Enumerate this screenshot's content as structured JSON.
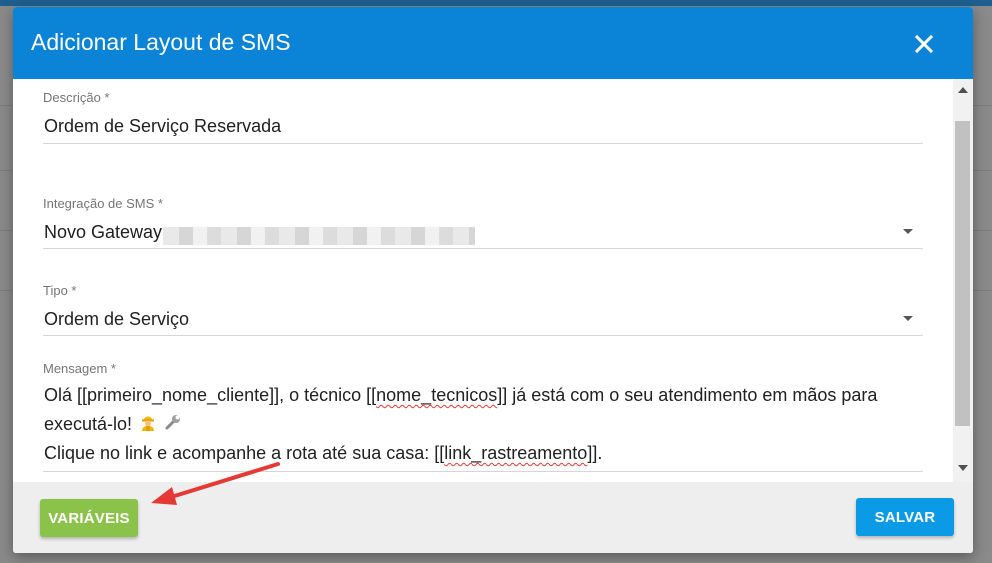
{
  "modal": {
    "title": "Adicionar Layout de SMS",
    "close_icon": "close-icon"
  },
  "form": {
    "descricao": {
      "label": "Descrição *",
      "value": "Ordem de Serviço Reservada"
    },
    "integracao": {
      "label": "Integração de SMS *",
      "value": "Novo Gateway"
    },
    "tipo": {
      "label": "Tipo *",
      "value": "Ordem de Serviço"
    },
    "mensagem": {
      "label": "Mensagem *",
      "line1_a": "Olá [[primeiro_nome_cliente]], o técnico [[",
      "line1_b": "nome_tecnicos",
      "line1_c": "]] já está com o seu atendimento em mãos para",
      "line2": "executá-lo!",
      "line2_icons": [
        "construction-worker-icon",
        "wrench-icon"
      ],
      "line3_a": "Clique no link e acompanhe a rota até sua casa: [[",
      "line3_b": "link_rastreamento",
      "line3_c": "]]."
    }
  },
  "footer": {
    "variables_label": "VARIÁVEIS",
    "save_label": "SALVAR"
  },
  "colors": {
    "header": "#0b83d6",
    "variables_button": "#8bc34a",
    "save_button": "#0b9be6",
    "annotation_arrow": "#e53935"
  }
}
